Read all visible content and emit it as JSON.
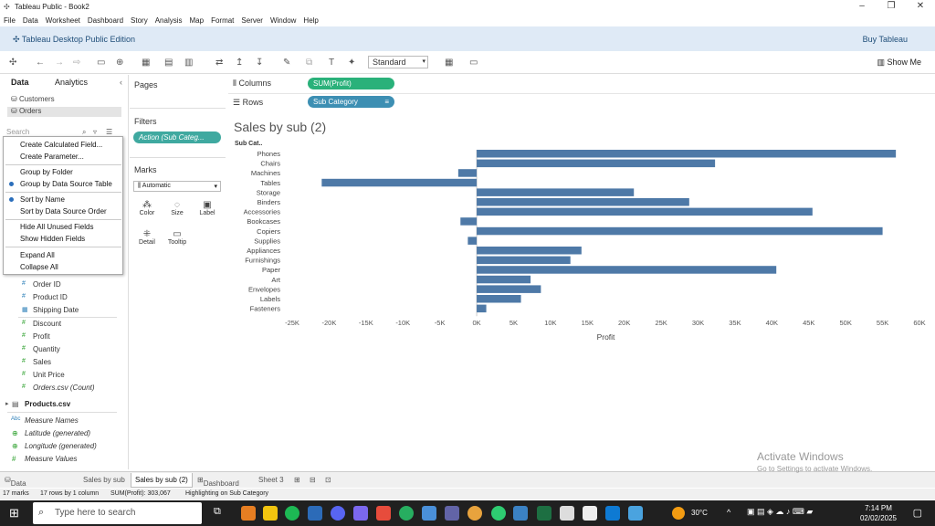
{
  "window": {
    "title": "Tableau Public - Book2",
    "minimize_icon": "minimize-icon",
    "maximize_icon": "maximize-icon",
    "close_icon": "close-icon"
  },
  "menu": [
    "File",
    "Data",
    "Worksheet",
    "Dashboard",
    "Story",
    "Analysis",
    "Map",
    "Format",
    "Server",
    "Window",
    "Help"
  ],
  "public_bar": {
    "edition": "Tableau Desktop Public Edition",
    "buy": "Buy Tableau"
  },
  "toolbar": {
    "fit": "Standard",
    "show_me": "Show Me"
  },
  "data_pane": {
    "tabs": [
      "Data",
      "Analytics"
    ],
    "sources": [
      "Customers",
      "Orders"
    ],
    "search_placeholder": "Search",
    "context_menu": [
      "Create Calculated Field...",
      "Create Parameter...",
      "Group by Folder",
      "Group by Data Source Table",
      "Sort by Name",
      "Sort by Data Source Order",
      "Hide All Unused Fields",
      "Show Hidden Fields",
      "Expand All",
      "Collapse All"
    ],
    "fields": [
      "Order ID",
      "Product ID",
      "Shipping Date",
      "Discount",
      "Profit",
      "Quantity",
      "Sales",
      "Unit Price",
      "Orders.csv (Count)"
    ],
    "table2": "Products.csv",
    "measures": [
      "Measure Names",
      "Latitude (generated)",
      "Longitude (generated)",
      "Measure Values"
    ]
  },
  "panels": {
    "pages": "Pages",
    "filters": "Filters",
    "filter_pill": "Action (Sub Categ...",
    "marks": "Marks",
    "mark_type": "Automatic",
    "mark_buttons": [
      "Color",
      "Size",
      "Label",
      "Detail",
      "Tooltip"
    ]
  },
  "shelves": {
    "columns_label": "Columns",
    "columns_pill": "SUM(Profit)",
    "rows_label": "Rows",
    "rows_pill": "Sub Category"
  },
  "sheet_title": "Sales by sub (2)",
  "row_header": "Sub Cat..",
  "chart_data": {
    "type": "bar",
    "orientation": "horizontal",
    "xlabel": "Profit",
    "ylabel": "Sub Category",
    "xlim": [
      -25000,
      60000
    ],
    "x_ticks": [
      "-25K",
      "-20K",
      "-15K",
      "-10K",
      "-5K",
      "0K",
      "5K",
      "10K",
      "15K",
      "20K",
      "25K",
      "30K",
      "35K",
      "40K",
      "45K",
      "50K",
      "55K",
      "60K"
    ],
    "categories": [
      "Phones",
      "Chairs",
      "Machines",
      "Tables",
      "Storage",
      "Binders",
      "Accessories",
      "Bookcases",
      "Copiers",
      "Supplies",
      "Appliances",
      "Furnishings",
      "Paper",
      "Art",
      "Envelopes",
      "Labels",
      "Fasteners"
    ],
    "values": [
      56800,
      32300,
      -2500,
      -21000,
      21300,
      28800,
      45500,
      -2200,
      55000,
      -1200,
      14200,
      12700,
      40600,
      7300,
      8700,
      6000,
      1300
    ],
    "bar_color": "#4e79a7"
  },
  "sheet_tabs": [
    "Data Source",
    "Sales by sub",
    "Sales by sub (2)",
    "Dashboard 1",
    "Sheet 3"
  ],
  "status": {
    "marks": "17 marks",
    "rows": "17 rows by 1 column",
    "sum": "SUM(Profit): 303,067",
    "highlight": "Highlighting on Sub Category"
  },
  "taskbar": {
    "search": "Type here to search",
    "temp": "30°C",
    "time": "7:14 PM",
    "date": "02/02/2025"
  },
  "watermark": {
    "title": "Activate Windows",
    "sub": "Go to Settings to activate Windows."
  }
}
